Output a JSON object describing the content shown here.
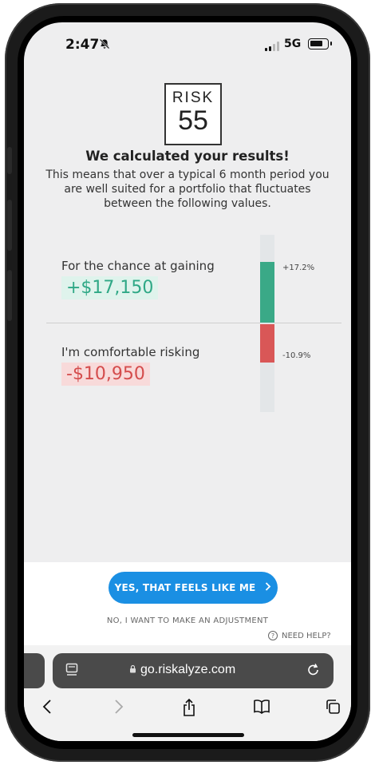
{
  "status_bar": {
    "time": "2:47",
    "network": "5G",
    "signal_bars": 4,
    "signal_bars_active": 2
  },
  "logo": {
    "word": "RISK",
    "number": "55"
  },
  "results": {
    "headline": "We calculated your results!",
    "description": "This means that over a typical 6 month period you are well suited for a portfolio that fluctuates between the following values.",
    "gain_label": "For the chance at gaining",
    "gain_value": "+$17,150",
    "gain_percent_label": "+17.2%",
    "gain_percent": 17.2,
    "risk_label": "I'm comfortable risking",
    "risk_value": "-$10,950",
    "risk_percent_label": "-10.9%",
    "risk_percent": -10.9
  },
  "colors": {
    "gain": "#3aa987",
    "risk": "#d95757",
    "cta": "#1a8fe3"
  },
  "actions": {
    "confirm_label": "YES, THAT FEELS LIKE ME",
    "adjust_label": "NO, I WANT TO MAKE AN ADJUSTMENT",
    "help_label": "NEED HELP?"
  },
  "browser": {
    "url": "go.riskalyze.com"
  },
  "icons": [
    "bell-slash-icon",
    "lock-icon",
    "reload-icon",
    "back-icon",
    "forward-icon",
    "share-icon",
    "bookmarks-icon",
    "tabs-icon",
    "help-icon",
    "chevron-right-icon"
  ]
}
